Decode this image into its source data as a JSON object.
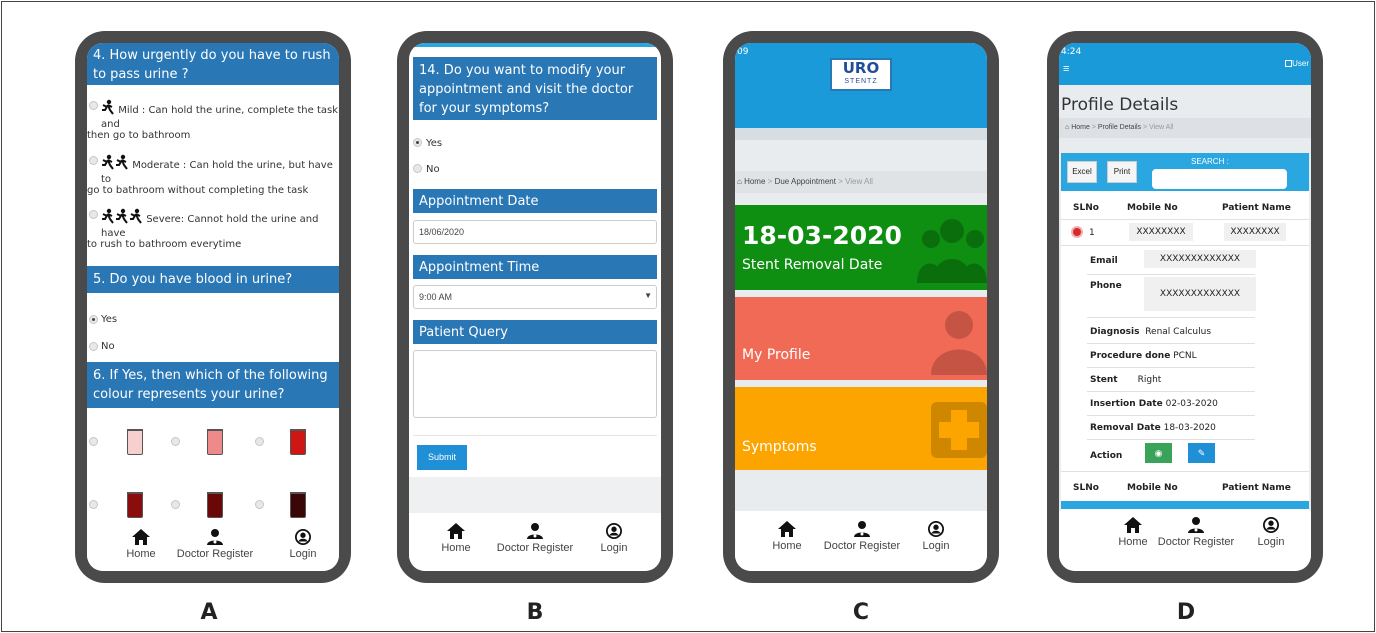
{
  "nav": {
    "home": "Home",
    "doctor": "Doctor Register",
    "login": "Login"
  },
  "labels": {
    "a": "A",
    "b": "B",
    "c": "C",
    "d": "D"
  },
  "phone_a": {
    "q4_title": "4. How urgently do you have to rush to pass urine ?",
    "opt_mild_1": "Mild : Can hold the urine, complete the task and",
    "opt_mild_2": "then go to bathroom",
    "opt_mod_1": "Moderate : Can hold the urine, but have to",
    "opt_mod_2": "go to bathroom without completing the task",
    "opt_sev_1": "Severe: Cannot hold the urine and have",
    "opt_sev_2": "to rush to bathroom everytime",
    "q5_title": "5. Do you have blood in urine?",
    "yes": "Yes",
    "no": "No",
    "q6_title": "6. If Yes, then which of the following colour represents your urine?"
  },
  "phone_b": {
    "q14_title": "14. Do you want to modify your appointment and visit the doctor for your symptoms?",
    "yes": "Yes",
    "no": "No",
    "date_label": "Appointment Date",
    "date_value": "18/06/2020",
    "time_label": "Appointment Time",
    "time_value": "9:00 AM",
    "query_label": "Patient Query",
    "submit": "Submit"
  },
  "phone_c": {
    "status_time": "09",
    "logo_top": "URO",
    "logo_bottom": "STENTZ",
    "crumb_home": "Home",
    "crumb_due": "Due Appointment",
    "crumb_view": "View All",
    "date": "18-03-2020",
    "date_caption": "Stent Removal Date",
    "profile": "My Profile",
    "symptoms": "Symptoms"
  },
  "phone_d": {
    "status_time": "4:24",
    "user": "User",
    "title": "Profile Details",
    "crumb_home": "Home",
    "crumb_profile": "Profile Details",
    "crumb_view": "View All",
    "excel": "Excel",
    "print": "Print",
    "search": "SEARCH :",
    "col_slno": "SLNo",
    "col_mobile": "Mobile No",
    "col_patient": "Patient Name",
    "row_no": "1",
    "row_mobile": "XXXXXXXX",
    "row_patient": "XXXXXXXX",
    "email_label": "Email",
    "email_value": "XXXXXXXXXXXXX",
    "phone_label": "Phone",
    "phone_value": "XXXXXXXXXXXXX",
    "diagnosis_label": "Diagnosis",
    "diagnosis_value": "Renal Calculus",
    "procedure_label": "Procedure done",
    "procedure_value": "PCNL",
    "stent_label": "Stent",
    "stent_value": "Right",
    "insertion_label": "Insertion Date",
    "insertion_value": "02-03-2020",
    "removal_label": "Removal Date",
    "removal_value": "18-03-2020",
    "action_label": "Action"
  },
  "colors": {
    "header_blue": "#2a77b6",
    "tile_green": "#0f8f12",
    "tile_red": "#f06a55",
    "tile_orange": "#fca400",
    "appbar_blue": "#1a9ad8"
  }
}
